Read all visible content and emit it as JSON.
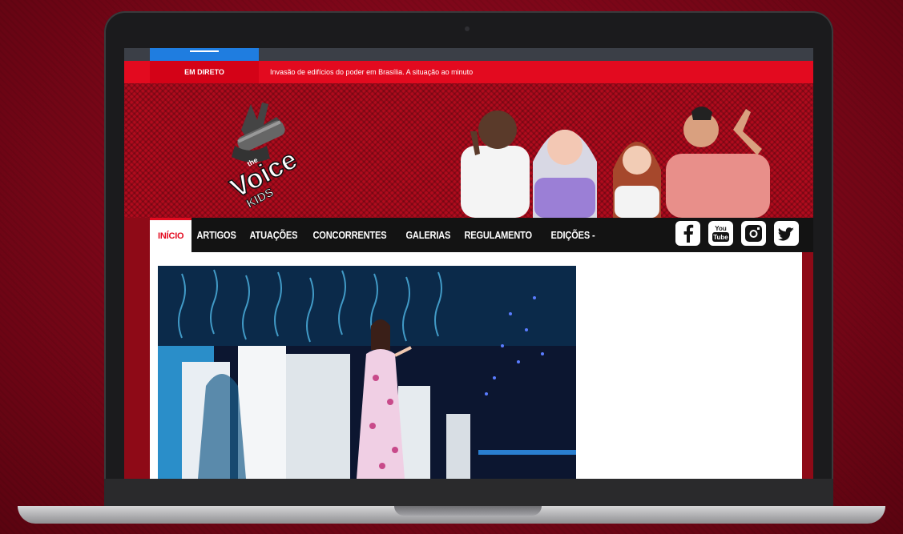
{
  "news_ticker": {
    "tag": "EM DIRETO",
    "headline": "Invasão de edifícios do poder em Brasília. A situação ao minuto"
  },
  "brand": {
    "logo_text_top": "the",
    "logo_text_main": "Voice",
    "logo_text_sub": "KIDS"
  },
  "nav": {
    "items": [
      {
        "label": "INÍCIO",
        "active": true
      },
      {
        "label": "ARTIGOS"
      },
      {
        "label": "ATUAÇÕES"
      },
      {
        "label": "CONCORRENTES"
      },
      {
        "label": "GALERIAS"
      },
      {
        "label": "REGULAMENTO"
      },
      {
        "label": "EDIÇÕES -"
      }
    ],
    "social_icons": [
      "facebook-icon",
      "youtube-icon",
      "instagram-icon",
      "twitter-icon"
    ],
    "youtube_text_1": "You",
    "youtube_text_2": "Tube"
  },
  "colors": {
    "brand_red": "#e30a1f",
    "nav_black": "#131313",
    "ticker_blue": "#1f7de0"
  }
}
